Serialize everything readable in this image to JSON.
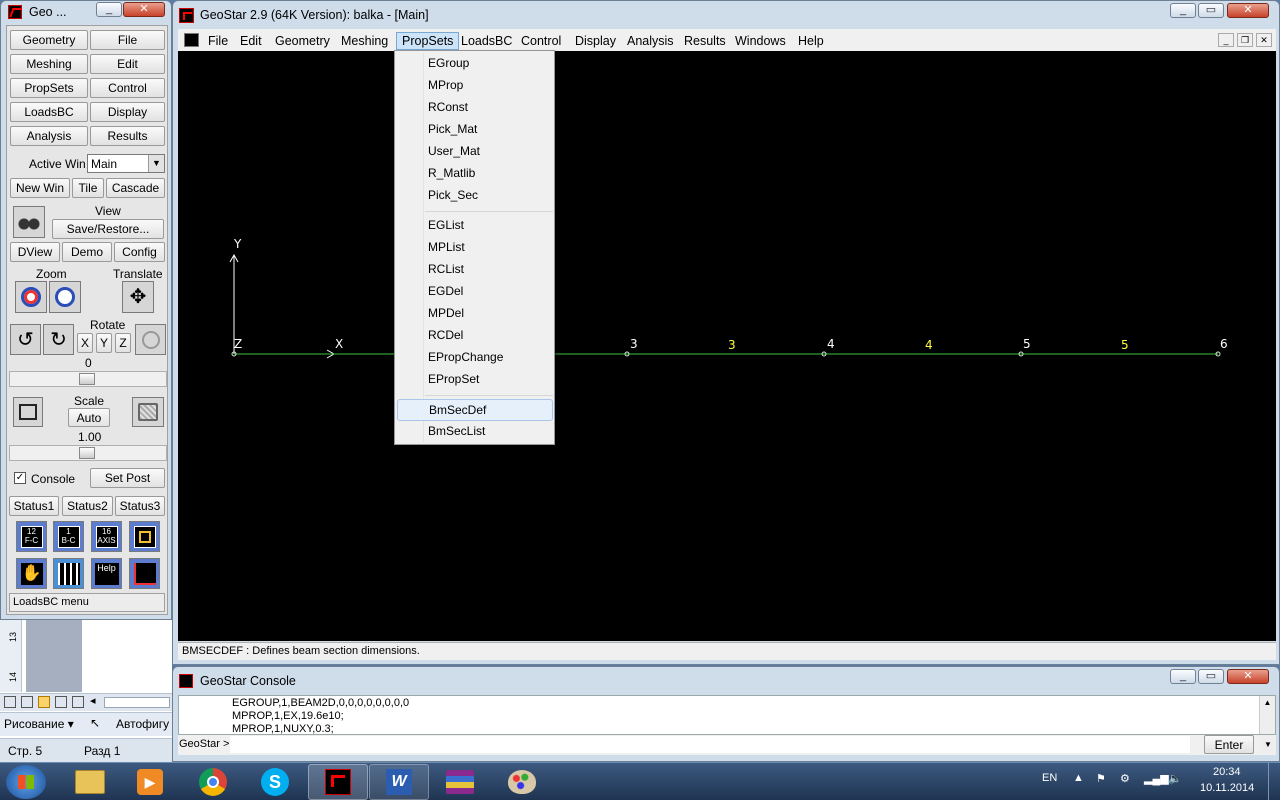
{
  "geo_panel": {
    "title": "Geo ...",
    "menu_buttons": [
      "Geometry",
      "File",
      "Meshing",
      "Edit",
      "PropSets",
      "Control",
      "LoadsBC",
      "Display",
      "Analysis",
      "Results"
    ],
    "active_win_label": "Active Win",
    "active_win_value": "Main",
    "win_buttons": [
      "New Win",
      "Tile",
      "Cascade"
    ],
    "view_label": "View",
    "save_restore": "Save/Restore...",
    "view_buttons": [
      "DView",
      "Demo",
      "Config"
    ],
    "zoom_label": "Zoom",
    "translate_label": "Translate",
    "rotate_label": "Rotate",
    "axis_buttons": [
      "X",
      "Y",
      "Z"
    ],
    "rotate_value": "0",
    "rotate_level": 0.5,
    "scale_label": "Scale",
    "auto_label": "Auto",
    "scale_value": "1.00",
    "scale_level": 0.5,
    "console_label": "Console",
    "console_checked": true,
    "set_post": "Set Post",
    "status_buttons": [
      "Status1",
      "Status2",
      "Status3"
    ],
    "icon_labels": [
      "12\nF-C",
      "1\nB-C",
      "16\nAXIS",
      "",
      "",
      "",
      "Help",
      ""
    ],
    "status_text": "LoadsBC menu"
  },
  "main_window": {
    "title": "GeoStar 2.9 (64K Version): balka - [Main]",
    "menu": [
      "File",
      "Edit",
      "Geometry",
      "Meshing",
      "PropSets",
      "LoadsBC",
      "Control",
      "Display",
      "Analysis",
      "Results",
      "Windows",
      "Help"
    ],
    "active_menu": "PropSets",
    "status_text": "BMSECDEF : Defines beam section dimensions."
  },
  "propsets_menu": {
    "group1": [
      "EGroup",
      "MProp",
      "RConst",
      "Pick_Mat",
      "User_Mat",
      "R_Matlib",
      "Pick_Sec"
    ],
    "group2": [
      "EGList",
      "MPList",
      "RCList",
      "EGDel",
      "MPDel",
      "RCDel",
      "EPropChange",
      "EPropSet"
    ],
    "group3": [
      "BmSecDef",
      "BmSecList"
    ],
    "highlighted": "BmSecDef"
  },
  "viewport": {
    "axis_y": "Y",
    "axis_x": "X",
    "axis_z": "Z",
    "node_labels": [
      "3",
      "4",
      "5",
      "6"
    ],
    "element_labels": [
      "3",
      "4",
      "5"
    ],
    "colors": {
      "background": "#000000",
      "beam": "#3fbf3f",
      "node_label": "#ffffff",
      "element_label": "#ffff3f"
    }
  },
  "console": {
    "title": "GeoStar Console",
    "lines": [
      "EGROUP,1,BEAM2D,0,0,0,0,0,0,0,0",
      "MPROP,1,EX,19.6e10;",
      "MPROP,1,NUXY,0.3;"
    ],
    "prompt": "GeoStar >",
    "enter": "Enter"
  },
  "word_bg": {
    "ruler": [
      "13",
      "14"
    ],
    "drawing": "Рисование",
    "autoshapes": "Автофигу",
    "page": "Стр. 5",
    "section": "Разд 1"
  },
  "taskbar": {
    "lang": "EN",
    "time": "20:34",
    "date": "10.11.2014"
  }
}
